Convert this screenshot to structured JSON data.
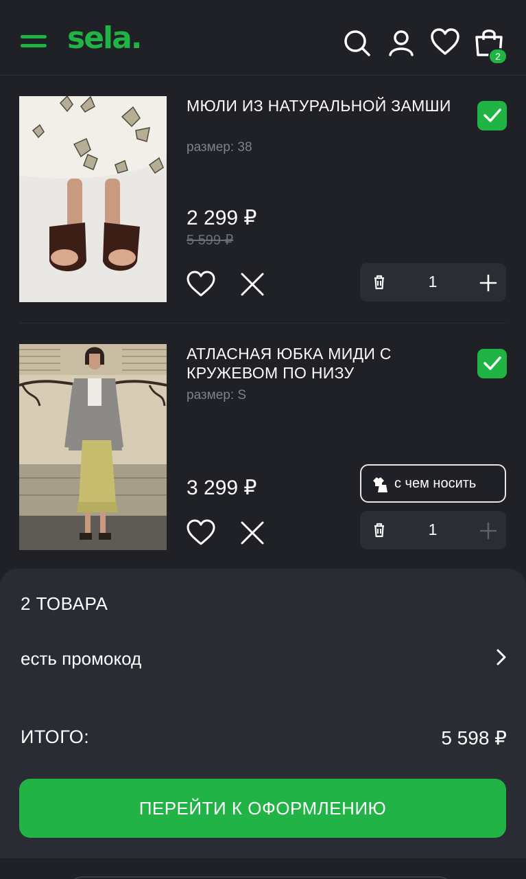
{
  "header": {
    "logo": "sela.",
    "cart_count": "2"
  },
  "items": [
    {
      "title": "МЮЛИ ИЗ НАТУРАЛЬНОЙ ЗАМШИ",
      "size": "размер: 38",
      "price": "2 299 ₽",
      "old_price": "5 599 ₽",
      "qty": "1",
      "selected": true
    },
    {
      "title": "АТЛАСНАЯ ЮБКА МИДИ С КРУЖЕВОМ ПО НИЗУ",
      "size": "размер: S",
      "price": "3 299 ₽",
      "qty": "1",
      "wear_label": "с чем носить",
      "selected": true
    }
  ],
  "summary": {
    "count": "2 ТОВАРА",
    "promo": "есть промокод",
    "total_label": "ИТОГО:",
    "total_value": "5 598 ₽",
    "checkout_label": "ПЕРЕЙТИ К ОФОРМЛЕНИЮ"
  },
  "colors": {
    "accent": "#1fb443",
    "background": "#1f2126",
    "panel": "#292c33"
  },
  "icons": [
    "menu-icon",
    "search-icon",
    "user-icon",
    "heart-icon",
    "cart-icon",
    "checkmark-icon",
    "trash-icon",
    "plus-icon",
    "close-icon",
    "outfit-icon",
    "chevron-right-icon"
  ]
}
